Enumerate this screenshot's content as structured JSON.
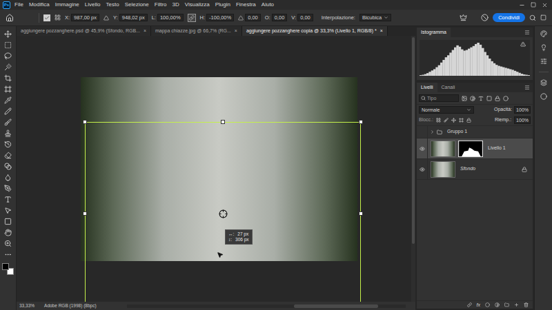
{
  "app": {
    "logo": "Ps",
    "menu": [
      "File",
      "Modifica",
      "Immagine",
      "Livello",
      "Testo",
      "Selezione",
      "Filtro",
      "3D",
      "Visualizza",
      "Plugin",
      "Finestra",
      "Aiuto"
    ]
  },
  "options_bar": {
    "reference_point_checked": true,
    "constrain_proportions": true,
    "fields": [
      {
        "kind": "label",
        "label": "X:",
        "value": "987,00 px"
      },
      {
        "kind": "label",
        "label": "Y:",
        "value": "948,02 px"
      },
      {
        "kind": "label",
        "label": "L:",
        "value": "100,00%"
      },
      {
        "kind": "label",
        "label": "H:",
        "value": "-100,00%"
      },
      {
        "kind": "angle",
        "label": "",
        "value": "0,00"
      },
      {
        "kind": "label",
        "label": "O:",
        "value": "0,00"
      },
      {
        "kind": "label",
        "label": "V:",
        "value": "0,00"
      }
    ],
    "interpolation_label": "Interpolazione:",
    "interpolation": "Bicubica",
    "share": "Condividi"
  },
  "tabs": [
    {
      "label": "aggiungere pozzanghere.psd @ 45,9% (Sfondo, RGB...",
      "close": "×",
      "selected": false
    },
    {
      "label": "mappa chiazze.jpg @ 66,7% (RG...",
      "close": "×",
      "selected": false
    },
    {
      "label": "aggiungere pozzanghere copia @ 33,3% (Livello 1, RGB/8) *",
      "close": "×",
      "selected": true
    }
  ],
  "transform_tooltip": [
    {
      "label": "↔:",
      "value": "27 px"
    },
    {
      "label": "↕:",
      "value": "306 px"
    }
  ],
  "status_bar": {
    "zoom": "33,33%",
    "profile": "Adobe RGB (1998) (8bpc)"
  },
  "histogram": {
    "tabs": [
      {
        "label": "Istogramma",
        "selected": true
      }
    ],
    "warning": true,
    "values": [
      2,
      3,
      5,
      8,
      12,
      16,
      20,
      26,
      32,
      40,
      48,
      56,
      62,
      70,
      78,
      86,
      92,
      88,
      80,
      76,
      78,
      82,
      86,
      90,
      96,
      100,
      94,
      84,
      72,
      62,
      52,
      44,
      38,
      33,
      30,
      28,
      26,
      24,
      22,
      20,
      18,
      15,
      12,
      9,
      6,
      4,
      3,
      2
    ]
  },
  "layers_panel": {
    "tabs": [
      {
        "label": "Livelli",
        "selected": true
      },
      {
        "label": "Canali",
        "selected": false
      }
    ],
    "search_placeholder": "Tipo",
    "blend_mode": "Normale",
    "opacity_label": "Opacità:",
    "opacity": "100%",
    "lock_label": "Blocc.:",
    "fill_label": "Riemp.:",
    "fill": "100%",
    "layers": [
      {
        "kind": "group",
        "name": "Gruppo 1",
        "visible": false,
        "expanded": false,
        "selected": false,
        "locked": false
      },
      {
        "kind": "layer",
        "name": "Livello 1",
        "visible": true,
        "expanded": false,
        "selected": true,
        "locked": false
      },
      {
        "kind": "background",
        "name": "Sfondo",
        "visible": true,
        "expanded": false,
        "selected": false,
        "locked": true
      }
    ],
    "footer_fx": "fx"
  }
}
